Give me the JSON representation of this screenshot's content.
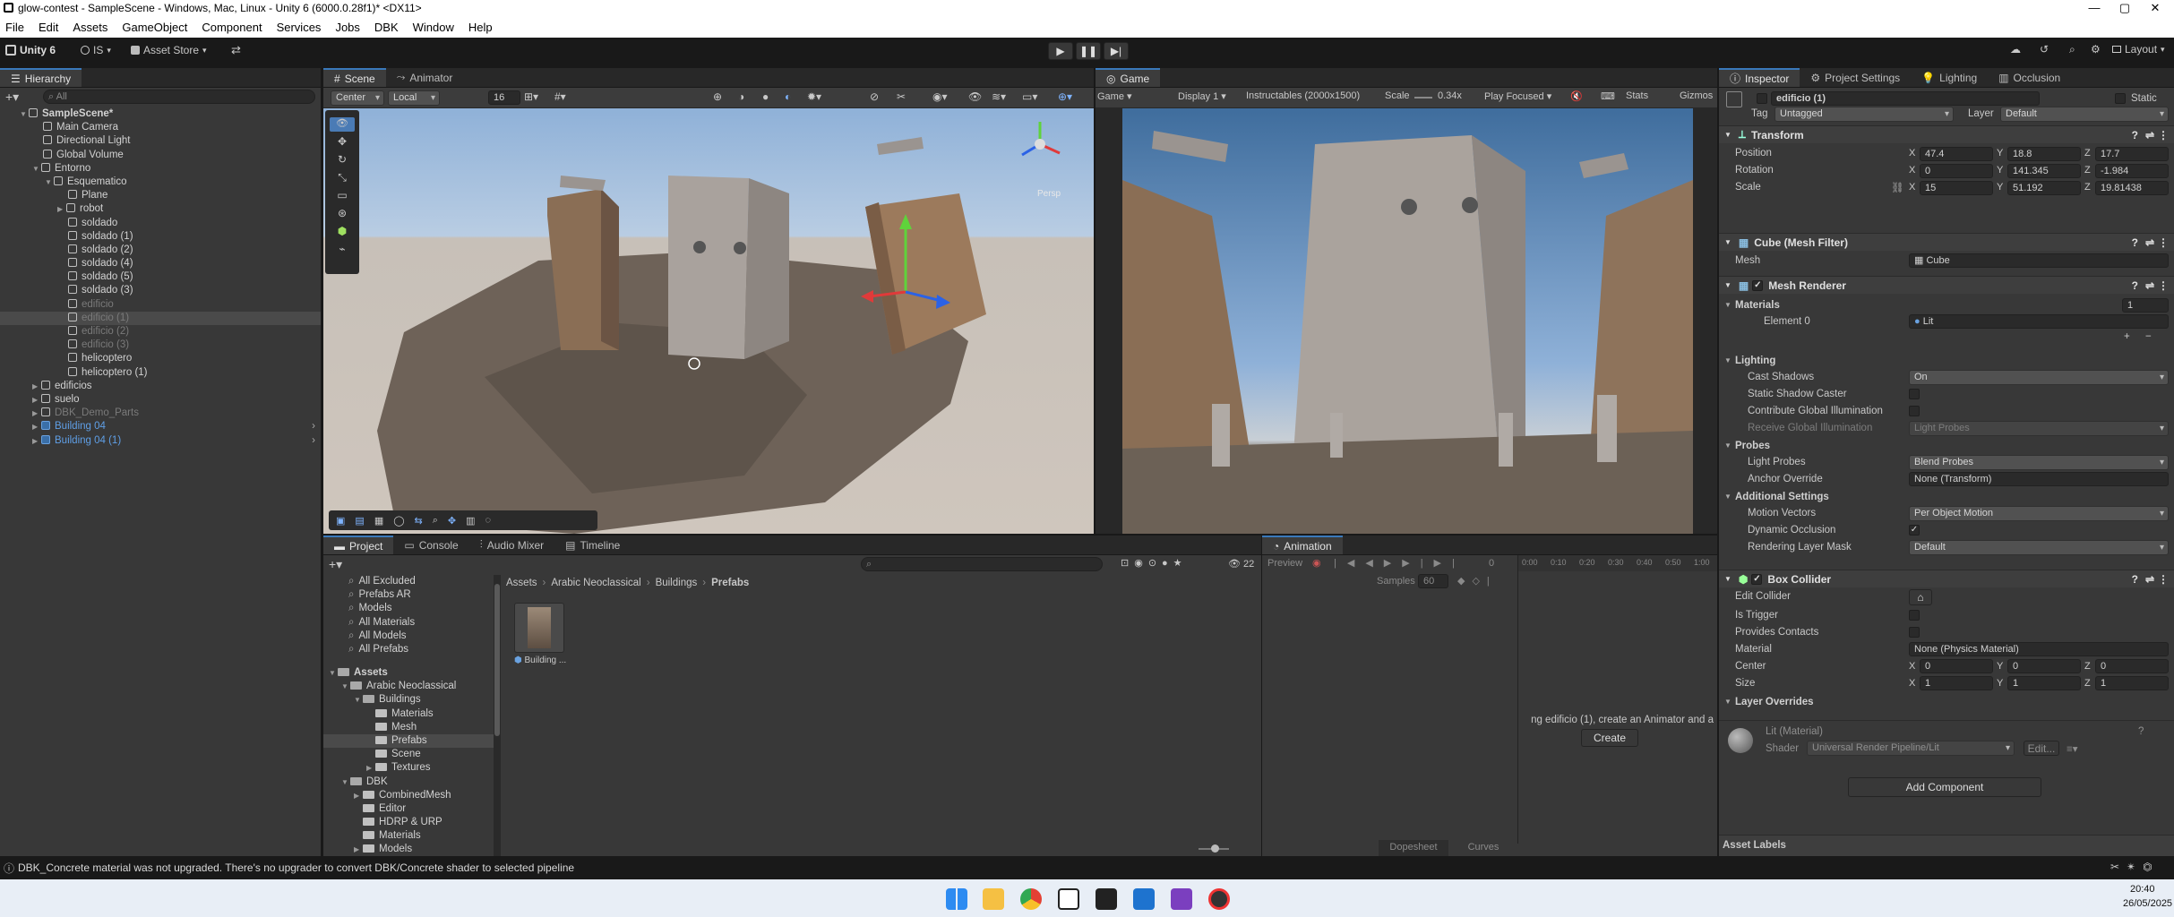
{
  "window": {
    "title": "glow-contest - SampleScene - Windows, Mac, Linux - Unity 6 (6000.0.28f1)* <DX11>"
  },
  "menu": [
    "File",
    "Edit",
    "Assets",
    "GameObject",
    "Component",
    "Services",
    "Jobs",
    "DBK",
    "Window",
    "Help"
  ],
  "toolbar": {
    "account": "Unity 6",
    "org": "IS",
    "asset_store": "Asset Store",
    "layout": "Layout"
  },
  "hierarchy": {
    "tab": "Hierarchy",
    "search_placeholder": "All",
    "items": [
      {
        "label": "SampleScene*",
        "depth": 0,
        "kind": "scene",
        "arrow": "▼"
      },
      {
        "label": "Main Camera",
        "depth": 1,
        "kind": "obj"
      },
      {
        "label": "Directional Light",
        "depth": 1,
        "kind": "obj"
      },
      {
        "label": "Global Volume",
        "depth": 1,
        "kind": "obj"
      },
      {
        "label": "Entorno",
        "depth": 1,
        "kind": "obj",
        "arrow": "▼"
      },
      {
        "label": "Esquematico",
        "depth": 2,
        "kind": "obj",
        "arrow": "▼"
      },
      {
        "label": "Plane",
        "depth": 3,
        "kind": "obj"
      },
      {
        "label": "robot",
        "depth": 3,
        "kind": "obj",
        "arrow": "▶"
      },
      {
        "label": "soldado",
        "depth": 3,
        "kind": "obj"
      },
      {
        "label": "soldado (1)",
        "depth": 3,
        "kind": "obj"
      },
      {
        "label": "soldado (2)",
        "depth": 3,
        "kind": "obj"
      },
      {
        "label": "soldado (4)",
        "depth": 3,
        "kind": "obj"
      },
      {
        "label": "soldado (5)",
        "depth": 3,
        "kind": "obj"
      },
      {
        "label": "soldado (3)",
        "depth": 3,
        "kind": "obj"
      },
      {
        "label": "edificio",
        "depth": 3,
        "kind": "obj",
        "dim": true
      },
      {
        "label": "edificio (1)",
        "depth": 3,
        "kind": "obj",
        "dim": true,
        "sel": true
      },
      {
        "label": "edificio (2)",
        "depth": 3,
        "kind": "obj",
        "dim": true
      },
      {
        "label": "edificio (3)",
        "depth": 3,
        "kind": "obj",
        "dim": true
      },
      {
        "label": "helicoptero",
        "depth": 3,
        "kind": "obj"
      },
      {
        "label": "helicoptero (1)",
        "depth": 3,
        "kind": "obj"
      },
      {
        "label": "edificios",
        "depth": 1,
        "kind": "obj",
        "arrow": "▶"
      },
      {
        "label": "suelo",
        "depth": 1,
        "kind": "obj",
        "arrow": "▶"
      },
      {
        "label": "DBK_Demo_Parts",
        "depth": 1,
        "kind": "obj",
        "arrow": "▶",
        "dim": true
      },
      {
        "label": "Building 04",
        "depth": 1,
        "kind": "prefab",
        "arrow": "▶",
        "blue": true
      },
      {
        "label": "Building 04 (1)",
        "depth": 1,
        "kind": "prefab",
        "arrow": "▶",
        "blue": true
      }
    ]
  },
  "scene": {
    "tabs": [
      "Scene",
      "Animator"
    ],
    "pivot": "Center",
    "space": "Local",
    "grid": "16",
    "persp": "Persp"
  },
  "game": {
    "tab": "Game",
    "mode": "Game",
    "display": "Display 1",
    "resolution": "Instructables (2000x1500)",
    "scale_label": "Scale",
    "scale": "0.34x",
    "play": "Play Focused",
    "stats": "Stats",
    "gizmos": "Gizmos"
  },
  "inspector": {
    "tabs": [
      "Inspector",
      "Project Settings",
      "Lighting",
      "Occlusion"
    ],
    "name": "edificio (1)",
    "static": "Static",
    "tag_label": "Tag",
    "tag": "Untagged",
    "layer_label": "Layer",
    "layer": "Default",
    "transform": {
      "title": "Transform",
      "position_label": "Position",
      "rotation_label": "Rotation",
      "scale_label": "Scale",
      "position": [
        "47.4",
        "18.8",
        "17.7"
      ],
      "rotation": [
        "0",
        "141.345",
        "-1.984"
      ],
      "scale": [
        "15",
        "51.192",
        "19.81438"
      ]
    },
    "mesh_filter": {
      "title": "Cube (Mesh Filter)",
      "mesh_label": "Mesh",
      "mesh": "Cube"
    },
    "mesh_renderer": {
      "title": "Mesh Renderer",
      "materials_label": "Materials",
      "materials_count": "1",
      "element0_label": "Element 0",
      "element0": "Lit",
      "lighting_label": "Lighting",
      "cast_shadows_label": "Cast Shadows",
      "cast_shadows": "On",
      "static_shadow_label": "Static Shadow Caster",
      "contribute_gi_label": "Contribute Global Illumination",
      "receive_gi_label": "Receive Global Illumination",
      "receive_gi": "Light Probes",
      "probes_label": "Probes",
      "light_probes_label": "Light Probes",
      "light_probes": "Blend Probes",
      "anchor_label": "Anchor Override",
      "anchor": "None (Transform)",
      "additional_label": "Additional Settings",
      "motion_vectors_label": "Motion Vectors",
      "motion_vectors": "Per Object Motion",
      "dynamic_occlusion_label": "Dynamic Occlusion",
      "rendering_layer_label": "Rendering Layer Mask",
      "rendering_layer": "Default"
    },
    "box_collider": {
      "title": "Box Collider",
      "edit_label": "Edit Collider",
      "trigger_label": "Is Trigger",
      "contacts_label": "Provides Contacts",
      "material_label": "Material",
      "material": "None (Physics Material)",
      "center_label": "Center",
      "center": [
        "0",
        "0",
        "0"
      ],
      "size_label": "Size",
      "size": [
        "1",
        "1",
        "1"
      ],
      "layer_overrides": "Layer Overrides"
    },
    "material": {
      "name": "Lit (Material)",
      "shader_label": "Shader",
      "shader": "Universal Render Pipeline/Lit",
      "edit": "Edit..."
    },
    "add_component": "Add Component",
    "asset_labels": "Asset Labels"
  },
  "project": {
    "tabs": [
      "Project",
      "Console",
      "Audio Mixer",
      "Timeline"
    ],
    "favorites": [
      "All Excluded",
      "Prefabs AR",
      "Models",
      "All Materials",
      "All Models",
      "All Prefabs"
    ],
    "tree": [
      {
        "label": "Assets",
        "depth": 0,
        "arrow": "▼",
        "bold": true
      },
      {
        "label": "Arabic Neoclassical",
        "depth": 1,
        "arrow": "▼"
      },
      {
        "label": "Buildings",
        "depth": 2,
        "arrow": "▼"
      },
      {
        "label": "Materials",
        "depth": 3
      },
      {
        "label": "Mesh",
        "depth": 3
      },
      {
        "label": "Prefabs",
        "depth": 3,
        "sel": true
      },
      {
        "label": "Scene",
        "depth": 3
      },
      {
        "label": "Textures",
        "depth": 3,
        "arrow": "▶"
      },
      {
        "label": "DBK",
        "depth": 1,
        "arrow": "▼"
      },
      {
        "label": "CombinedMesh",
        "depth": 2,
        "arrow": "▶"
      },
      {
        "label": "Editor",
        "depth": 2
      },
      {
        "label": "HDRP & URP",
        "depth": 2
      },
      {
        "label": "Materials",
        "depth": 2
      },
      {
        "label": "Models",
        "depth": 2,
        "arrow": "▶"
      }
    ],
    "breadcrumb": [
      "Assets",
      "Arabic Neoclassical",
      "Buildings",
      "Prefabs"
    ],
    "asset": "Building ...",
    "count": "22"
  },
  "animation": {
    "tab": "Animation",
    "preview": "Preview",
    "samples_label": "Samples",
    "samples": "60",
    "frame": "0",
    "ticks": [
      "0:00",
      "0:10",
      "0:20",
      "0:30",
      "0:40",
      "0:50",
      "1:00"
    ],
    "message": "ng edificio (1), create an Animator and a",
    "create": "Create",
    "dopesheet": "Dopesheet",
    "curves": "Curves"
  },
  "status": {
    "message": "DBK_Concrete material was not upgraded. There's no upgrader to convert DBK/Concrete shader to selected pipeline"
  },
  "taskbar": {
    "time": "20:40",
    "date": "26/05/2025"
  }
}
